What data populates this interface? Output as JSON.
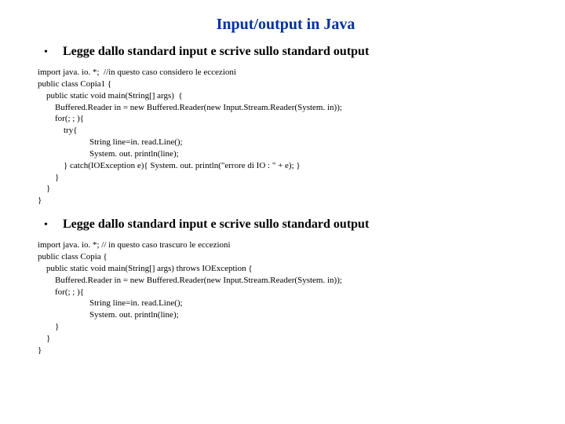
{
  "title": "Input/output in Java",
  "sections": [
    {
      "bullet": "Legge dallo standard input e scrive sullo standard output",
      "code": "import java. io. *;  //in questo caso considero le eccezioni\npublic class Copia1 {\n    public static void main(String[] args)  {\n        Buffered.Reader in = new Buffered.Reader(new Input.Stream.Reader(System. in));\n        for(; ; ){\n            try{\n                        String line=in. read.Line();\n                        System. out. println(line);\n            } catch(IOException e){ System. out. println(\"errore di IO : \" + e); }\n        }\n    }\n}"
    },
    {
      "bullet": "Legge dallo standard input e scrive sullo standard output",
      "code": "import java. io. *; // in questo caso trascuro le eccezioni\npublic class Copia {\n    public static void main(String[] args) throws IOException {\n        Buffered.Reader in = new Buffered.Reader(new Input.Stream.Reader(System. in));\n        for(; ; ){\n                        String line=in. read.Line();\n                        System. out. println(line);\n        }\n    }\n}"
    }
  ]
}
